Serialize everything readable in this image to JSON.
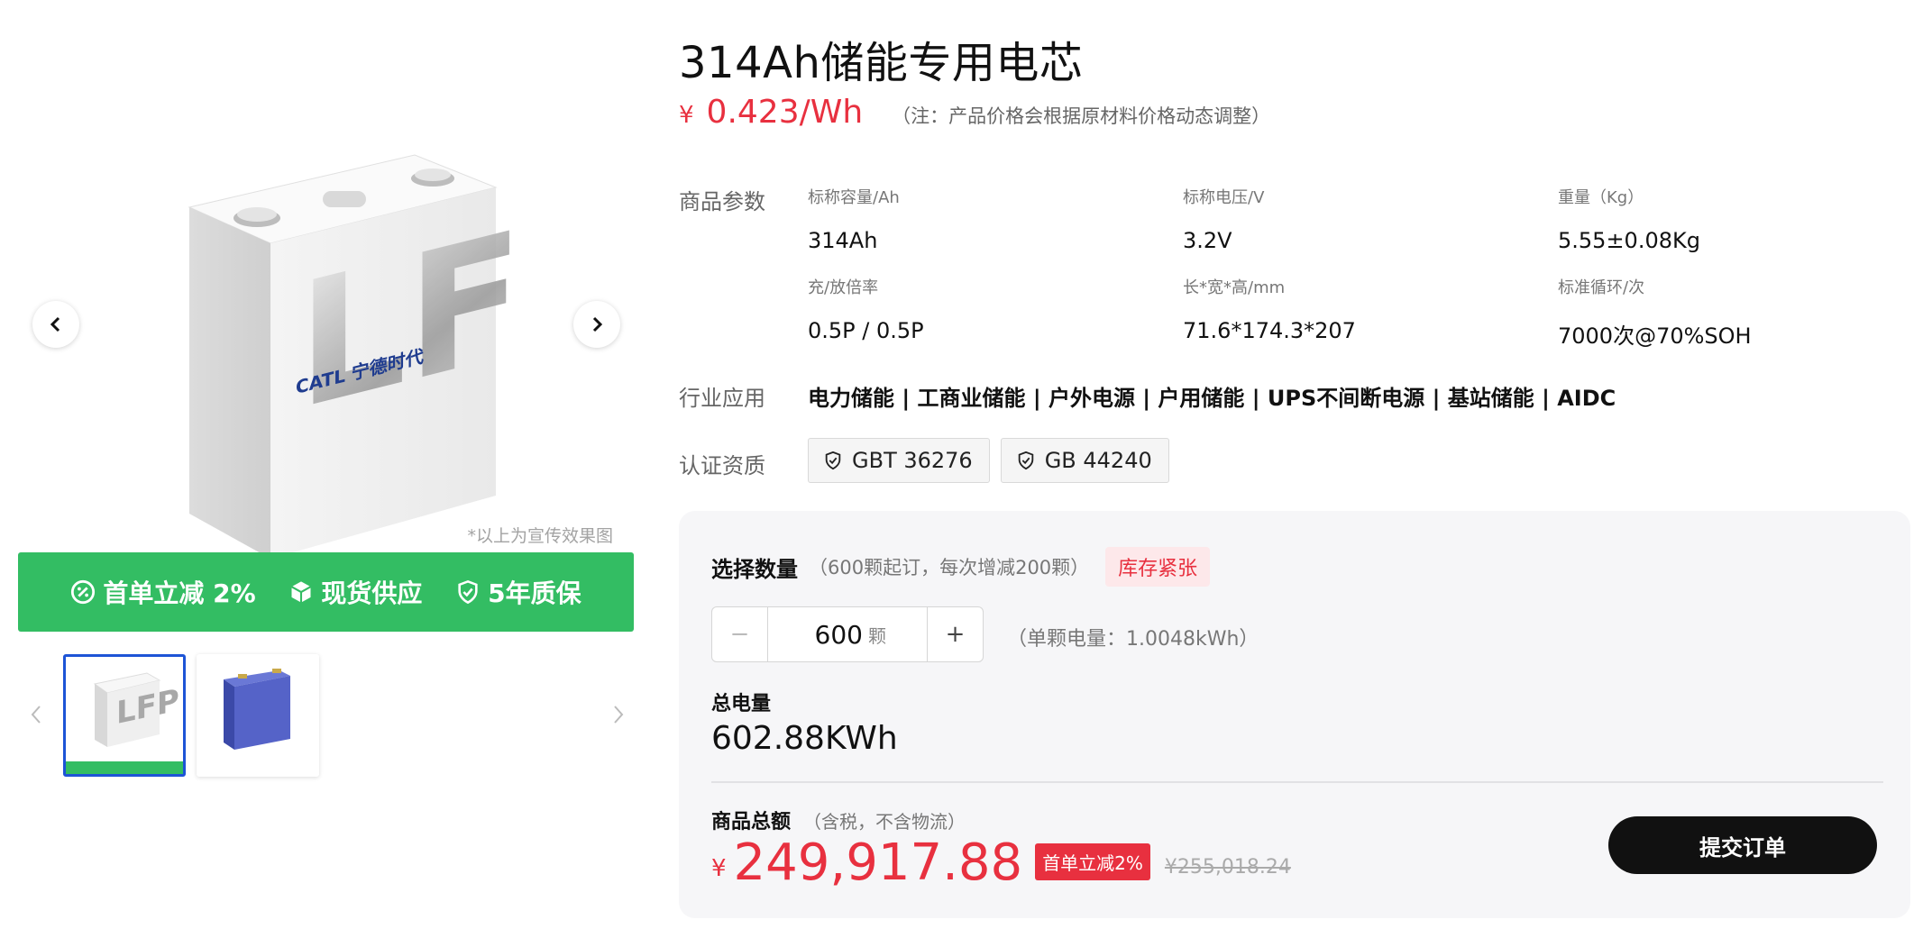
{
  "product": {
    "title": "314Ah储能专用电芯",
    "price_symbol": "¥",
    "price": "0.423/Wh",
    "price_note": "（注：产品价格会根据原材料价格动态调整）"
  },
  "gallery": {
    "image_note": "*以上为宣传效果图",
    "cell_brand": "CATL 宁德时代",
    "cell_mark": "LFP",
    "promo": [
      {
        "icon": "discount-icon",
        "label": "首单立减 2%"
      },
      {
        "icon": "cube-icon",
        "label": "现货供应"
      },
      {
        "icon": "shield-check-icon",
        "label": "5年质保"
      }
    ]
  },
  "params": {
    "label": "商品参数",
    "items": [
      {
        "label": "标称容量/Ah",
        "value": "314Ah"
      },
      {
        "label": "标称电压/V",
        "value": "3.2V"
      },
      {
        "label": "重量（Kg）",
        "value": "5.55±0.08Kg"
      },
      {
        "label": "充/放倍率",
        "value": "0.5P / 0.5P"
      },
      {
        "label": "长*宽*高/mm",
        "value": "71.6*174.3*207"
      },
      {
        "label": "标准循环/次",
        "value": "7000次@70%SOH"
      }
    ]
  },
  "applications": {
    "label": "行业应用",
    "value": "电力储能 | 工商业储能 | 户外电源 | 户用储能 | UPS不间断电源 | 基站储能 | AIDC"
  },
  "certifications": {
    "label": "认证资质",
    "items": [
      "GBT 36276",
      "GB 44240"
    ]
  },
  "order": {
    "qty_title": "选择数量",
    "qty_rule": "（600颗起订，每次增减200颗）",
    "stock_badge": "库存紧张",
    "minus": "−",
    "plus": "+",
    "quantity": "600",
    "qty_unit": "颗",
    "unit_energy": "（单颗电量：1.0048kWh）",
    "total_energy_label": "总电量",
    "total_energy": "602.88KWh",
    "sum_title": "商品总额",
    "sum_note": "（含税，不含物流）",
    "sum_symbol": "¥",
    "sum_value": "249,917.88",
    "discount_badge": "首单立减2%",
    "original_price": "¥255,018.24",
    "submit_label": "提交订单"
  },
  "colors": {
    "accent_red": "#e8303f",
    "promo_green": "#33bd63",
    "thumb_selected": "#1d54d6",
    "button_dark": "#111111"
  }
}
